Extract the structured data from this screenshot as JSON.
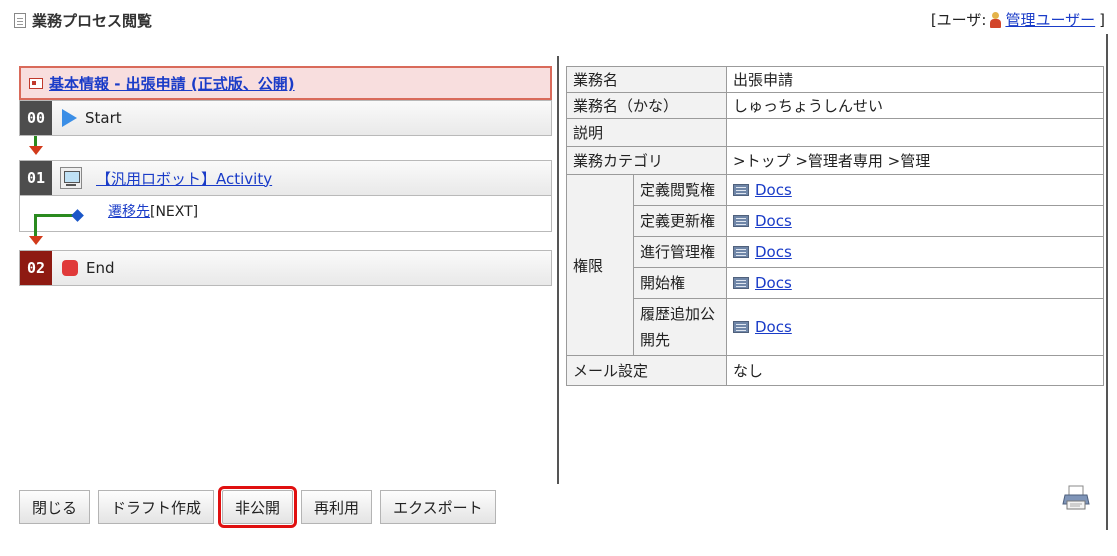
{
  "header": {
    "page_title": "業務プロセス閲覧",
    "user_prefix": "[ユーザ:",
    "user_name": "管理ユーザー",
    "user_suffix": "]"
  },
  "flow": {
    "basic_info_link": "基本情報 - 出張申請 (正式版、公開)",
    "steps": [
      {
        "num": "00",
        "label": "Start"
      },
      {
        "num": "01",
        "label": "【汎用ロボット】Activity"
      },
      {
        "num": "02",
        "label": "End"
      }
    ],
    "transition": {
      "link": "遷移先",
      "tag": "[NEXT]"
    }
  },
  "info_table": {
    "business_name_label": "業務名",
    "business_name": "出張申請",
    "kana_label": "業務名（かな）",
    "kana": "しゅっちょうしんせい",
    "desc_label": "説明",
    "desc": "",
    "category_label": "業務カテゴリ",
    "category": ">トップ >管理者専用 >管理",
    "perm_label": "権限",
    "permissions": [
      {
        "label": "定義閲覧権",
        "value": "Docs"
      },
      {
        "label": "定義更新権",
        "value": "Docs"
      },
      {
        "label": "進行管理権",
        "value": "Docs"
      },
      {
        "label": "開始権",
        "value": "Docs"
      },
      {
        "label": "履歴追加公開先",
        "value": "Docs"
      }
    ],
    "mail_label": "メール設定",
    "mail": "なし"
  },
  "buttons": {
    "close": "閉じる",
    "draft": "ドラフト作成",
    "unpublish": "非公開",
    "reuse": "再利用",
    "export": "エクスポート"
  },
  "icons": [
    "page-icon",
    "user-icon",
    "basic-info-icon",
    "start-play-icon",
    "robot-icon",
    "end-stop-icon",
    "docs-icon",
    "printer-icon"
  ],
  "colors": {
    "link": "#1a3cc8",
    "highlight": "#e01010",
    "flow_line": "#2a8a1f",
    "arrow": "#d23a1a",
    "end_badge": "#8e1a12"
  }
}
